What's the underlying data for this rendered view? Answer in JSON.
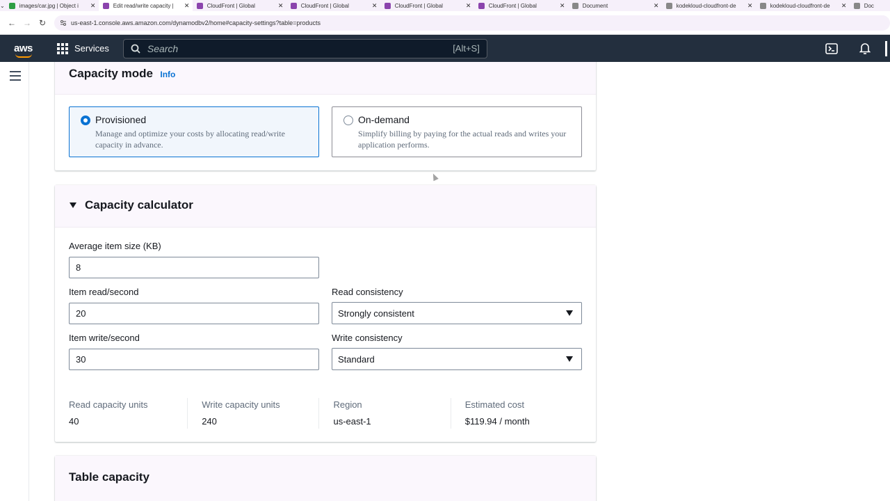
{
  "browser": {
    "tabs": [
      {
        "title": "images/car.jpg | Object i",
        "color": "#2e9e44",
        "active": false
      },
      {
        "title": "Edit read/write capacity |",
        "color": "#8b44ad",
        "active": true
      },
      {
        "title": "CloudFront | Global",
        "color": "#8b44ad",
        "active": false
      },
      {
        "title": "CloudFront | Global",
        "color": "#8b44ad",
        "active": false
      },
      {
        "title": "CloudFront | Global",
        "color": "#8b44ad",
        "active": false
      },
      {
        "title": "CloudFront | Global",
        "color": "#8b44ad",
        "active": false
      },
      {
        "title": "Document",
        "color": "#888888",
        "active": false
      },
      {
        "title": "kodekloud-cloudfront-de",
        "color": "#888888",
        "active": false
      },
      {
        "title": "kodekloud-cloudfront-de",
        "color": "#888888",
        "active": false
      },
      {
        "title": "Doc",
        "color": "#888888",
        "active": false
      }
    ],
    "url": "us-east-1.console.aws.amazon.com/dynamodbv2/home#capacity-settings?table=products"
  },
  "awsnav": {
    "logo": "aws",
    "services_label": "Services",
    "search_placeholder": "Search",
    "search_shortcut": "[Alt+S]"
  },
  "capacity_mode": {
    "title": "Capacity mode",
    "info": "Info",
    "options": [
      {
        "label": "Provisioned",
        "desc": "Manage and optimize your costs by allocating read/write capacity in advance.",
        "selected": true
      },
      {
        "label": "On-demand",
        "desc": "Simplify billing by paying for the actual reads and writes your application performs.",
        "selected": false
      }
    ]
  },
  "calculator": {
    "title": "Capacity calculator",
    "avg_item_size": {
      "label": "Average item size (KB)",
      "value": "8"
    },
    "item_read": {
      "label": "Item read/second",
      "value": "20"
    },
    "item_write": {
      "label": "Item write/second",
      "value": "30"
    },
    "read_consistency": {
      "label": "Read consistency",
      "value": "Strongly consistent"
    },
    "write_consistency": {
      "label": "Write consistency",
      "value": "Standard"
    },
    "summary": {
      "rcu_label": "Read capacity units",
      "rcu_value": "40",
      "wcu_label": "Write capacity units",
      "wcu_value": "240",
      "region_label": "Region",
      "region_value": "us-east-1",
      "cost_label": "Estimated cost",
      "cost_value": "$119.94 / month"
    }
  },
  "table_capacity": {
    "title": "Table capacity"
  }
}
